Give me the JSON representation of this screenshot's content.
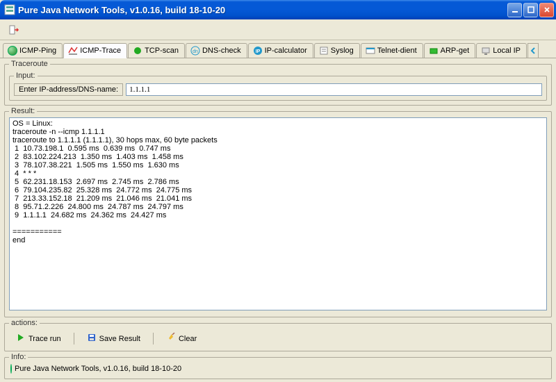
{
  "window": {
    "title": "Pure Java Network Tools,  v1.0.16, build 18-10-20"
  },
  "tabs": [
    {
      "label": "ICMP-Ping",
      "icon": "globe"
    },
    {
      "label": "ICMP-Trace",
      "icon": "chart",
      "active": true
    },
    {
      "label": "TCP-scan",
      "icon": "green-dot"
    },
    {
      "label": "DNS-check",
      "icon": "dns"
    },
    {
      "label": "IP-calculator",
      "icon": "ip"
    },
    {
      "label": "Syslog",
      "icon": "syslog"
    },
    {
      "label": "Telnet-dient",
      "icon": "telnet"
    },
    {
      "label": "ARP-get",
      "icon": "arp"
    },
    {
      "label": "Local IP",
      "icon": "localip"
    }
  ],
  "panel": {
    "traceroute_legend": "Traceroute",
    "input_legend": "Input:",
    "input_label": "Enter IP-address/DNS-name:",
    "input_value": "1.1.1.1",
    "result_legend": "Result:",
    "result_text": "OS = Linux:\ntraceroute -n --icmp 1.1.1.1\ntraceroute to 1.1.1.1 (1.1.1.1), 30 hops max, 60 byte packets\n 1  10.73.198.1  0.595 ms  0.639 ms  0.747 ms\n 2  83.102.224.213  1.350 ms  1.403 ms  1.458 ms\n 3  78.107.38.221  1.505 ms  1.550 ms  1.630 ms\n 4  * * *\n 5  62.231.18.153  2.697 ms  2.745 ms  2.786 ms\n 6  79.104.235.82  25.328 ms  24.772 ms  24.775 ms\n 7  213.33.152.18  21.209 ms  21.046 ms  21.041 ms\n 8  95.71.2.226  24.800 ms  24.787 ms  24.797 ms\n 9  1.1.1.1  24.682 ms  24.362 ms  24.427 ms\n\n===========\nend",
    "actions_legend": "actions:",
    "actions": {
      "trace": "Trace run",
      "save": "Save Result",
      "clear": "Clear"
    },
    "info_legend": "Info:",
    "info_text": "Pure Java Network Tools,  v1.0.16, build 18-10-20"
  }
}
